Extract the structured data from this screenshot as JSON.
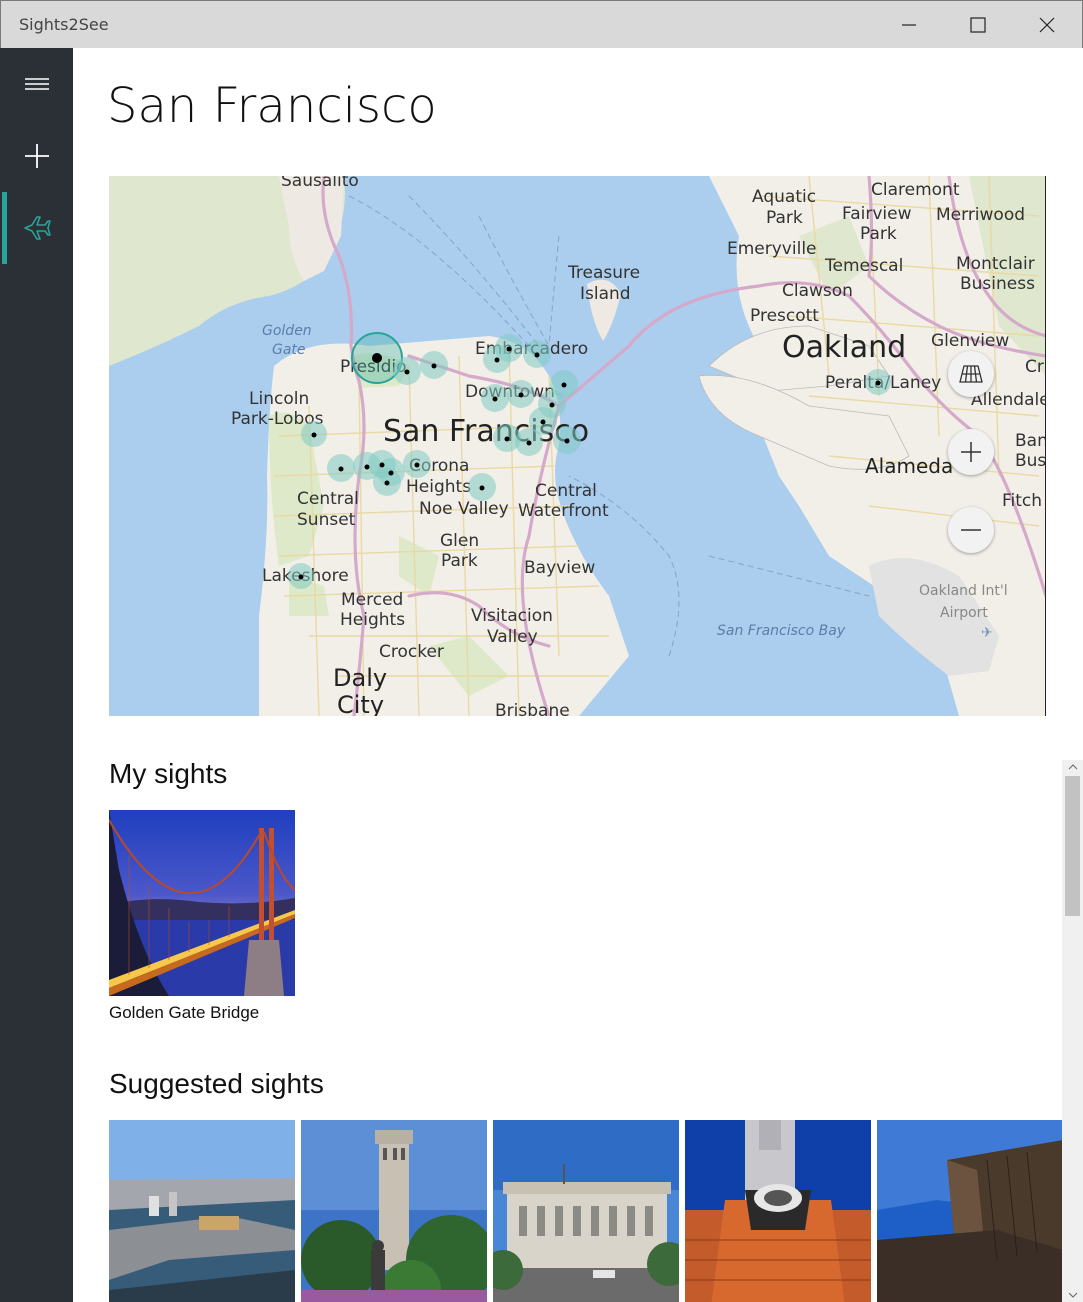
{
  "window": {
    "title": "Sights2See"
  },
  "nav": {
    "items": [
      "menu",
      "add",
      "trips"
    ],
    "selected": "trips"
  },
  "page": {
    "title": "San Francisco"
  },
  "map": {
    "labels": {
      "sausalito": "Sausalito",
      "golden_gate_1": "Golden",
      "golden_gate_2": "Gate",
      "presidio": "Presidio",
      "embarcadero": "Embarcadero",
      "lincoln_1": "Lincoln",
      "lincoln_2": "Park-Lobos",
      "downtown": "Downtown",
      "sf": "San Francisco",
      "corona_1": "Corona",
      "corona_2": "Heights",
      "central_sunset_1": "Central",
      "central_sunset_2": "Sunset",
      "noe_valley": "Noe Valley",
      "central_wf_1": "Central",
      "central_wf_2": "Waterfront",
      "glen_park_1": "Glen",
      "glen_park_2": "Park",
      "bayview": "Bayview",
      "lakeshore": "Lakeshore",
      "merced_1": "Merced",
      "merced_2": "Heights",
      "visitacion_1": "Visitacion",
      "visitacion_2": "Valley",
      "crocker": "Crocker",
      "daly_city_1": "Daly",
      "daly_city_2": "City",
      "brisbane": "Brisbane",
      "treasure_1": "Treasure",
      "treasure_2": "Island",
      "aquatic_1": "Aquatic",
      "aquatic_2": "Park",
      "claremont": "Claremont",
      "fairview_1": "Fairview",
      "fairview_2": "Park",
      "merriwood": "Merriwood",
      "emeryville": "Emeryville",
      "temescal": "Temescal",
      "montclair_1": "Montclair",
      "montclair_2": "Business",
      "clawson": "Clawson",
      "prescott": "Prescott",
      "oakland": "Oakland",
      "glenview": "Glenview",
      "peralta": "Peralta/Laney",
      "allendale": "Allendale",
      "alameda": "Alameda",
      "sf_bay": "San Francisco Bay",
      "oak_airport_1": "Oakland Int'l",
      "oak_airport_2": "Airport",
      "fitch": "Fitch",
      "ban_1": "Ban",
      "ban_2": "Bus",
      "cr": "Cr"
    },
    "controls": [
      "map-style",
      "zoom-in",
      "zoom-out"
    ]
  },
  "my_sights": {
    "heading": "My sights",
    "items": [
      {
        "label": "Golden Gate Bridge"
      }
    ]
  },
  "suggested_sights": {
    "heading": "Suggested sights",
    "count_visible": 5
  },
  "colors": {
    "accent": "#2aa39a",
    "sidebar": "#2b3036",
    "titlebar": "#d9d9d9",
    "water": "#abcdee",
    "land": "#f2efe9"
  }
}
